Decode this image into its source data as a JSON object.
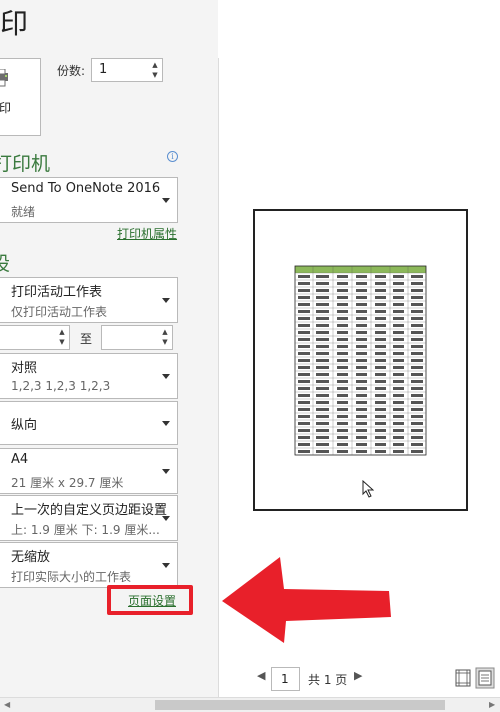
{
  "header": {
    "title": "印"
  },
  "print_button": {
    "label": "打印"
  },
  "copies": {
    "label": "份数:",
    "value": "1"
  },
  "printer": {
    "section_title": "打印机",
    "name": "Send To OneNote 2016",
    "status": "就绪",
    "properties_link": "打印机属性",
    "info_icon": "info-icon"
  },
  "settings": {
    "section_title": "设",
    "scope": {
      "main": "打印活动工作表",
      "sub": "仅打印活动工作表"
    },
    "pages": {
      "from": "",
      "to_label": "至",
      "to": ""
    },
    "collate": {
      "main": "对照",
      "sub": "1,2,3    1,2,3    1,2,3"
    },
    "orientation": {
      "main": "纵向"
    },
    "paper": {
      "main": "A4",
      "sub": "21 厘米 x 29.7 厘米"
    },
    "margins": {
      "main": "上一次的自定义页边距设置",
      "sub": "上: 1.9 厘米 下: 1.9 厘米..."
    },
    "scaling": {
      "main": "无缩放",
      "sub": "打印实际大小的工作表"
    },
    "page_setup_link": "页面设置"
  },
  "preview": {
    "current_page": "1",
    "total_pages": "共 1 页",
    "header_color": "#8cb85a",
    "highlight_color": "#e8202a"
  }
}
